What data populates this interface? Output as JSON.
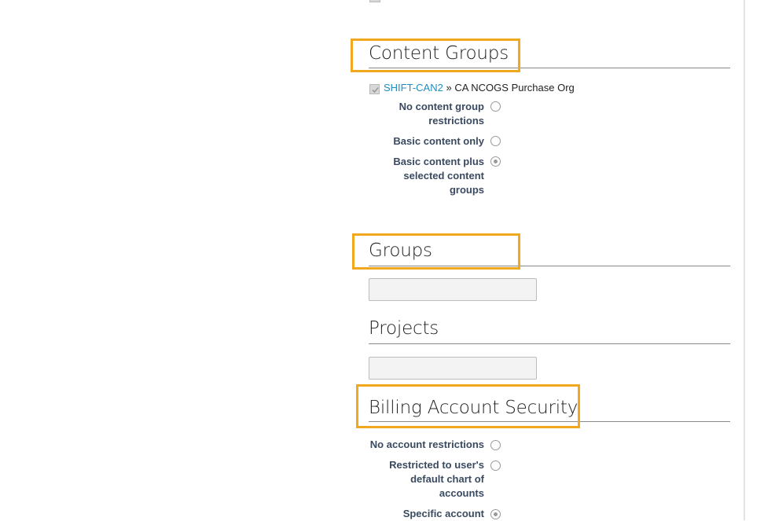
{
  "content_groups": {
    "title": "Content Groups",
    "link_text": "SHIFT-CAN2",
    "separator": "»",
    "org_text": "CA NCOGS Purchase Org",
    "options": [
      {
        "label_lines": [
          "No content group",
          "restrictions"
        ],
        "selected": false
      },
      {
        "label_lines": [
          "Basic content only"
        ],
        "selected": false
      },
      {
        "label_lines": [
          "Basic content plus",
          "selected content",
          "groups"
        ],
        "selected": true
      }
    ]
  },
  "groups": {
    "title": "Groups",
    "value": ""
  },
  "projects": {
    "title": "Projects",
    "value": ""
  },
  "billing": {
    "title": "Billing Account Security",
    "options": [
      {
        "label_lines": [
          "No account restrictions"
        ],
        "selected": false
      },
      {
        "label_lines": [
          "Restricted to user's",
          "default chart of",
          "accounts"
        ],
        "selected": false
      },
      {
        "label_lines": [
          "Specific account"
        ],
        "selected": true
      }
    ]
  },
  "colors": {
    "highlight": "#f0a81e",
    "link": "#1f8fbf",
    "label": "#3a4a60"
  }
}
